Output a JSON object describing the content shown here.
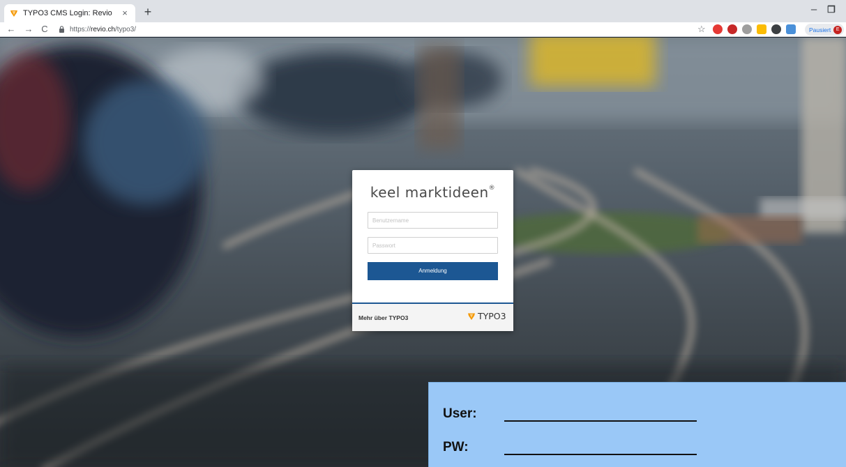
{
  "browser": {
    "tab_title": "TYPO3 CMS Login: Revio",
    "tab_close": "×",
    "new_tab": "+",
    "url_prefix": "https://",
    "url_host": "revio.ch",
    "url_path": "/typo3/",
    "profile_label": "Pausiert",
    "profile_initial": "E",
    "window_minimize": "–",
    "window_restore": "❐"
  },
  "login": {
    "brand": "keel marktideen",
    "brand_reg": "®",
    "username_placeholder": "Benutzername",
    "password_placeholder": "Passwort",
    "submit_label": "Anmeldung",
    "more_link": "Mehr über TYPO3",
    "typo3_logo_text": "TYPO3"
  },
  "annotation": {
    "user_label": "User:",
    "pw_label": "PW:"
  },
  "colors": {
    "typo3_orange": "#f49700",
    "button_blue": "#1c5793",
    "annotation_blue": "#9ac8f7"
  }
}
